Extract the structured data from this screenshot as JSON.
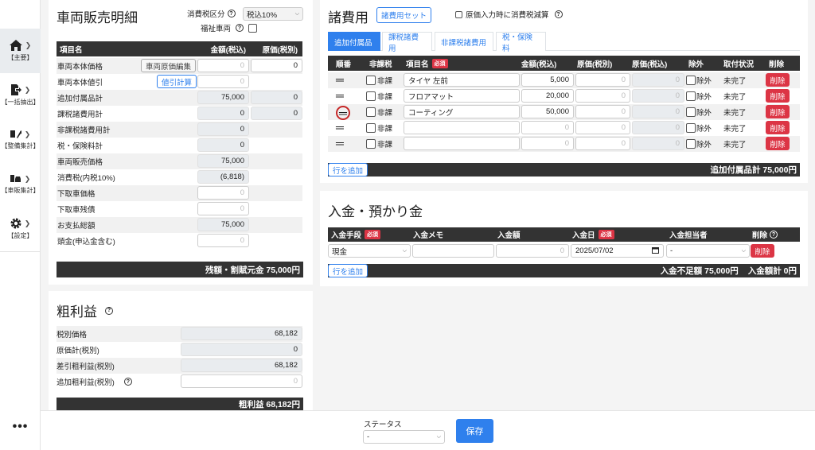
{
  "sidebar": {
    "items": [
      {
        "label": "【主要】",
        "icon": "home-icon"
      },
      {
        "label": "【一括抽出】",
        "icon": "export-icon"
      },
      {
        "label": "【整備集計】",
        "icon": "wrench-icon"
      },
      {
        "label": "【車販集計】",
        "icon": "car-icon"
      },
      {
        "label": "【設定】",
        "icon": "gear-icon"
      }
    ],
    "more": "•••"
  },
  "sales": {
    "title": "車両販売明細",
    "tax_label": "消費税区分",
    "tax_value": "税込10%",
    "welfare_label": "福祉車両",
    "headers": {
      "item": "項目名",
      "amount": "金額(税込)",
      "cost": "原価(税別)"
    },
    "rows": [
      {
        "name": "車両本体価格",
        "button": "車両原価編集",
        "amount": "0",
        "cost": "0"
      },
      {
        "name": "車両本体値引",
        "button": "値引計算",
        "amount": "0",
        "cost": ""
      },
      {
        "name": "追加付属品計",
        "button": "",
        "amount": "75,000",
        "cost": "0"
      },
      {
        "name": "課税諸費用計",
        "button": "",
        "amount": "0",
        "cost": "0"
      },
      {
        "name": "非課税諸費用計",
        "button": "",
        "amount": "0",
        "cost": ""
      },
      {
        "name": "税・保険料計",
        "button": "",
        "amount": "0",
        "cost": ""
      },
      {
        "name": "車両販売価格",
        "button": "",
        "amount": "75,000",
        "cost": ""
      },
      {
        "name": "消費税(内税10%)",
        "button": "",
        "amount": "(6,818)",
        "cost": ""
      },
      {
        "name": "下取車価格",
        "button": "",
        "amount": "0",
        "cost": ""
      },
      {
        "name": "下取車残債",
        "button": "",
        "amount": "0",
        "cost": ""
      },
      {
        "name": "お支払総額",
        "button": "",
        "amount": "75,000",
        "cost": ""
      },
      {
        "name": "頭金(申込金含む)",
        "button": "",
        "amount": "0",
        "cost": ""
      }
    ],
    "footer": "残額・割賦元金 75,000円"
  },
  "profit": {
    "title": "粗利益",
    "rows": [
      {
        "name": "税別価格",
        "value": "68,182"
      },
      {
        "name": "原価計(税別)",
        "value": "0"
      },
      {
        "name": "差引粗利益(税別)",
        "value": "68,182"
      },
      {
        "name": "追加粗利益(税別)",
        "value": "0"
      }
    ],
    "footer": "粗利益 68,182円"
  },
  "expenses": {
    "title": "諸費用",
    "set_button": "諸費用セット",
    "cost_reduce_label": "原価入力時に消費税減算",
    "tabs": [
      "追加付属品",
      "課税諸費用",
      "非課税諸費用",
      "税・保険料"
    ],
    "headers": {
      "order": "順番",
      "nontax": "非課税",
      "item": "項目名",
      "required": "必須",
      "amount": "金額(税込)",
      "cost1": "原価(税別)",
      "cost2": "原価(税込)",
      "exclude": "除外",
      "status": "取付状況",
      "delete": "削除"
    },
    "rows": [
      {
        "handle": "═",
        "nontax": "非課",
        "item": "タイヤ 左前",
        "amount": "5,000",
        "cost1": "0",
        "cost2": "0",
        "exclude": "除外",
        "status": "未完了",
        "delete": "削除"
      },
      {
        "handle": "═",
        "nontax": "非課",
        "item": "フロアマット",
        "amount": "20,000",
        "cost1": "0",
        "cost2": "0",
        "exclude": "除外",
        "status": "未完了",
        "delete": "削除"
      },
      {
        "handle": "═",
        "nontax": "非課",
        "item": "コーティング",
        "amount": "50,000",
        "cost1": "0",
        "cost2": "0",
        "exclude": "除外",
        "status": "未完了",
        "delete": "削除"
      },
      {
        "handle": "═",
        "nontax": "非課",
        "item": "",
        "amount": "0",
        "cost1": "0",
        "cost2": "0",
        "exclude": "除外",
        "status": "未完了",
        "delete": "削除"
      },
      {
        "handle": "═",
        "nontax": "非課",
        "item": "",
        "amount": "0",
        "cost1": "0",
        "cost2": "0",
        "exclude": "除外",
        "status": "未完了",
        "delete": "削除"
      }
    ],
    "add_row": "行を追加",
    "total": "追加付属品計 75,000円"
  },
  "deposit": {
    "title": "入金・預かり金",
    "headers": {
      "method": "入金手段",
      "memo": "入金メモ",
      "amount": "入金額",
      "date": "入金日",
      "person": "入金担当者",
      "delete": "削除",
      "required": "必須"
    },
    "row": {
      "method": "現金",
      "memo": "",
      "amount": "0",
      "date": "2025/07/02",
      "person": "-",
      "delete": "削除"
    },
    "add_row": "行を追加",
    "shortfall": "入金不足額 75,000円",
    "total": "入金額計 0円"
  },
  "bottom": {
    "status_label": "ステータス",
    "status_value": "-",
    "save": "保存"
  },
  "colors": {
    "accent": "#2f80ed",
    "danger": "#dc3545",
    "dark": "#333333"
  }
}
